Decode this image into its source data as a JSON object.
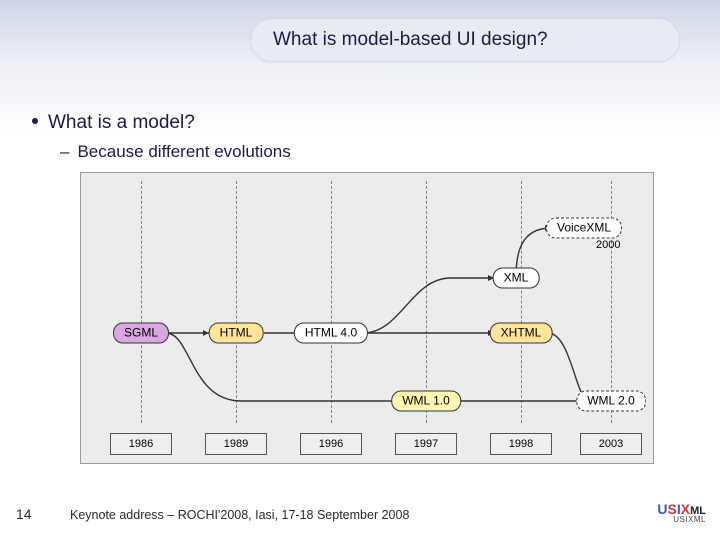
{
  "title": "What is model-based UI design?",
  "bullet_main": "What is a model?",
  "bullet_sub": "Because different evolutions",
  "years": [
    "1986",
    "1989",
    "1996",
    "1997",
    "1998",
    "2003"
  ],
  "nodes": {
    "sgml": "SGML",
    "html": "HTML",
    "html40": "HTML 4.0",
    "xml": "XML",
    "xhtml": "XHTML",
    "voicexml": "VoiceXML",
    "voiceyear": "2000",
    "wml10": "WML 1.0",
    "wml20": "WML 2.0"
  },
  "page_number": "14",
  "footer_text": "Keynote address – ROCHI'2008, Iasi, 17-18 September 2008",
  "logo": {
    "top_u": "U",
    "top_s": "S",
    "top_i": "I",
    "top_x": "X",
    "top_ml": "ML",
    "bottom": "USIXML"
  }
}
